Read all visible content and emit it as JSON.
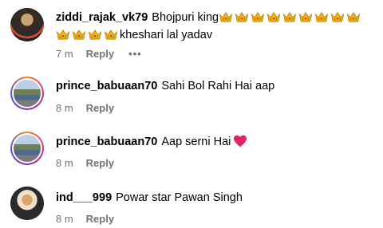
{
  "comments": [
    {
      "username": "ziddi_rajak_vk79",
      "text_before": "Bhojpuri king",
      "text_after": "kheshari lal yadav",
      "time": "7 m",
      "reply_label": "Reply",
      "more_label": "•••",
      "emoji": "crown-emoji"
    },
    {
      "username": "prince_babuaan70",
      "text": "Sahi Bol Rahi Hai aap",
      "time": "8 m",
      "reply_label": "Reply"
    },
    {
      "username": "prince_babuaan70",
      "text": "Aap serni Hai",
      "time": "8 m",
      "reply_label": "Reply",
      "emoji": "red-heart-emoji"
    },
    {
      "username": "ind___999",
      "text": "Powar star Pawan Singh",
      "time": "8 m",
      "reply_label": "Reply"
    }
  ],
  "colors": {
    "meta_gray": "#737373",
    "heart_red": "#e0245e",
    "crown_gold": "#f5b400"
  }
}
